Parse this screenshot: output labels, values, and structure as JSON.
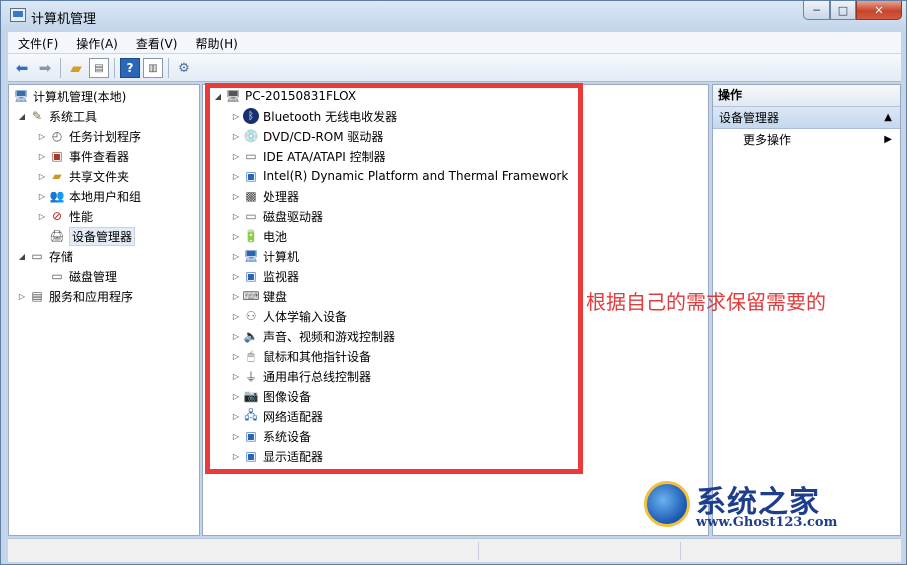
{
  "window": {
    "title": "计算机管理",
    "min_glyph": "─",
    "max_glyph": "□",
    "close_glyph": "✕"
  },
  "menu": [
    "文件(F)",
    "操作(A)",
    "查看(V)",
    "帮助(H)"
  ],
  "toolbar_icons": [
    "back-arrow-icon",
    "forward-arrow-icon",
    "up-folder-icon",
    "show-hide-tree-icon",
    "help-icon",
    "action-pane-icon",
    "properties-icon"
  ],
  "left_tree": {
    "root": "计算机管理(本地)",
    "system_tools": "系统工具",
    "task_scheduler": "任务计划程序",
    "event_viewer": "事件查看器",
    "shared_folders": "共享文件夹",
    "local_users": "本地用户和组",
    "performance": "性能",
    "device_manager": "设备管理器",
    "storage": "存储",
    "disk_management": "磁盘管理",
    "services_apps": "服务和应用程序"
  },
  "device_tree": {
    "computer_name": "PC-20150831FLOX",
    "categories": [
      "Bluetooth 无线电收发器",
      "DVD/CD-ROM 驱动器",
      "IDE ATA/ATAPI 控制器",
      "Intel(R) Dynamic Platform and Thermal Framework",
      "处理器",
      "磁盘驱动器",
      "电池",
      "计算机",
      "监视器",
      "键盘",
      "人体学输入设备",
      "声音、视频和游戏控制器",
      "鼠标和其他指针设备",
      "通用串行总线控制器",
      "图像设备",
      "网络适配器",
      "系统设备",
      "显示适配器"
    ]
  },
  "actions": {
    "header": "操作",
    "section": "设备管理器",
    "more": "更多操作"
  },
  "annotation": "根据自己的需求保留需要的",
  "watermark": {
    "title": "系统之家",
    "url": "www.Ghost123.com"
  },
  "colors": {
    "highlight_box": "#ea3b3b",
    "annotation_text": "#e23b3b"
  }
}
